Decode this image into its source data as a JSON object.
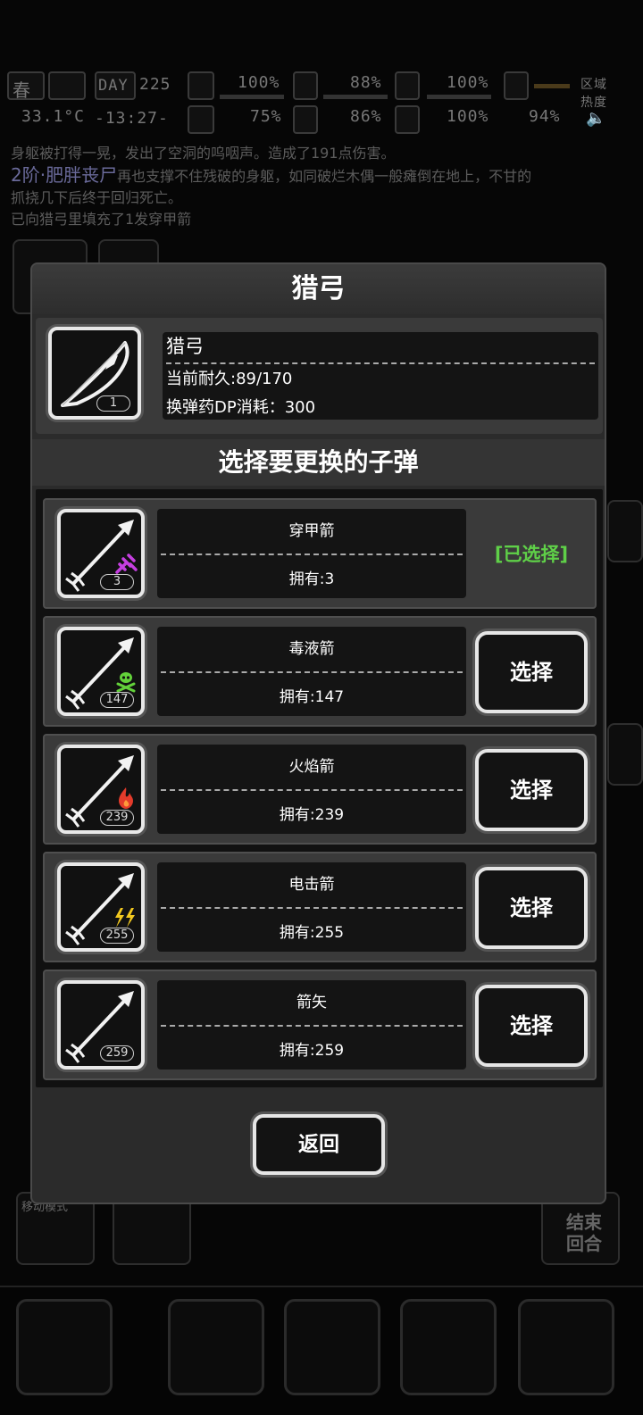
{
  "hud": {
    "season": "春",
    "day_label": "DAY",
    "day_number": "225",
    "temperature": "33.1°C",
    "clock": "-13:27-",
    "stats": [
      {
        "name": "health",
        "value": "100%"
      },
      {
        "name": "hunger",
        "value": "88%"
      },
      {
        "name": "stamina",
        "value": "100%"
      },
      {
        "name": "sanity",
        "value": "75%"
      },
      {
        "name": "thirst",
        "value": "86%"
      },
      {
        "name": "mood",
        "value": "100%"
      },
      {
        "name": "speed",
        "value": "94%"
      }
    ],
    "zone_label": "区域",
    "heat_label": "热度"
  },
  "log": {
    "line1": "身躯被打得一晃，发出了空洞的呜咽声。造成了191点伤害。",
    "line2_enemy": "2阶·肥胖丧尸",
    "line2_rest": "再也支撑不住残破的身躯，如同破烂木偶一般瘫倒在地上，不甘的",
    "line3": "抓挠几下后终于回归死亡。",
    "line4": "已向猎弓里填充了1发穿甲箭"
  },
  "side": {
    "move_mode_label": "移动模式",
    "end_turn_label": "结束回合"
  },
  "dialog": {
    "title": "猎弓",
    "weapon": {
      "name": "猎弓",
      "durability": "当前耐久:89/170",
      "reload_cost": "换弹药DP消耗：300",
      "count": "1"
    },
    "subtitle": "选择要更换的子弹",
    "ammo": [
      {
        "name": "穿甲箭",
        "owned": "拥有:3",
        "count": "3",
        "selected": true,
        "status_label": "[已选择]",
        "emblem": "pierce-icon",
        "emblem_color": "#c63fe0"
      },
      {
        "name": "毒液箭",
        "owned": "拥有:147",
        "count": "147",
        "selected": false,
        "button_label": "选择",
        "emblem": "skull-crossbones-icon",
        "emblem_color": "#63d23a"
      },
      {
        "name": "火焰箭",
        "owned": "拥有:239",
        "count": "239",
        "selected": false,
        "button_label": "选择",
        "emblem": "flame-icon",
        "emblem_color": "#e33b2b"
      },
      {
        "name": "电击箭",
        "owned": "拥有:255",
        "count": "255",
        "selected": false,
        "button_label": "选择",
        "emblem": "lightning-icon",
        "emblem_color": "#f2c81f"
      },
      {
        "name": "箭矢",
        "owned": "拥有:259",
        "count": "259",
        "selected": false,
        "button_label": "选择",
        "emblem": "",
        "emblem_color": ""
      }
    ],
    "back_label": "返回"
  },
  "colors": {
    "selected_green": "#5fd048",
    "panel": "#3a3a3a",
    "dialog": "#2b2b2b"
  }
}
